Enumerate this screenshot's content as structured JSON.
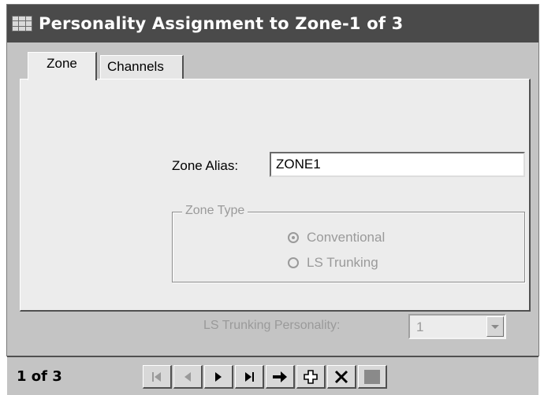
{
  "window": {
    "title": "Personality Assignment to Zone-1 of 3"
  },
  "tabs": [
    {
      "label": "Zone",
      "active": true
    },
    {
      "label": "Channels",
      "active": false
    }
  ],
  "zone": {
    "alias_label": "Zone Alias:",
    "alias_value": "ZONE1",
    "zone_type": {
      "legend": "Zone Type",
      "options": [
        {
          "label": "Conventional",
          "selected": true,
          "enabled": false
        },
        {
          "label": "LS Trunking",
          "selected": false,
          "enabled": false
        }
      ]
    },
    "ls_trunking_personality": {
      "label": "LS Trunking Personality:",
      "value": "1",
      "enabled": false
    }
  },
  "status": {
    "record_count": "1 of 3"
  },
  "navigator": {
    "buttons": [
      {
        "icon": "first-record-icon",
        "enabled": false
      },
      {
        "icon": "previous-record-icon",
        "enabled": false
      },
      {
        "icon": "next-record-icon",
        "enabled": true
      },
      {
        "icon": "last-record-icon",
        "enabled": true
      },
      {
        "icon": "go-to-record-icon",
        "enabled": true
      },
      {
        "icon": "add-record-icon",
        "enabled": true
      },
      {
        "icon": "delete-record-icon",
        "enabled": true
      },
      {
        "icon": "save-record-icon",
        "enabled": false
      }
    ]
  }
}
